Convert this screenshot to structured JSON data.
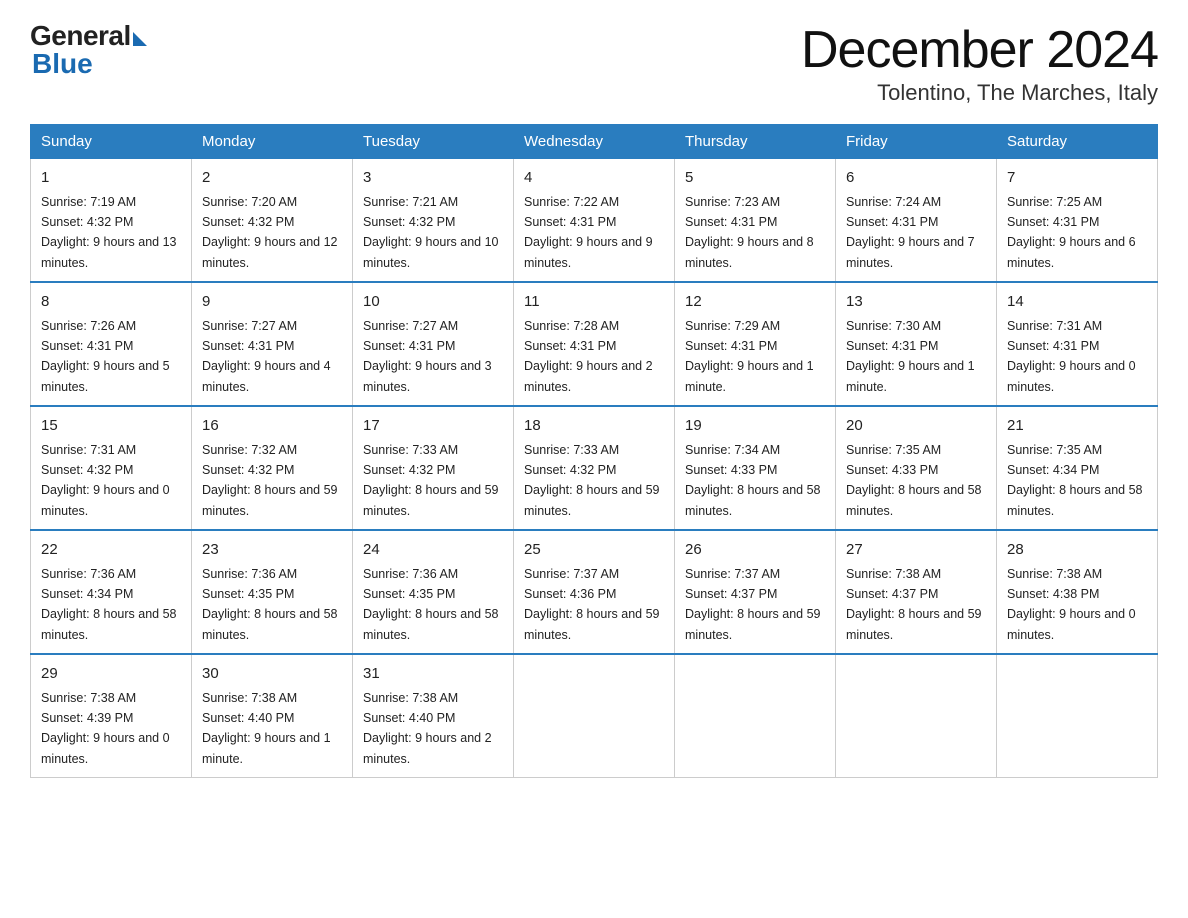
{
  "header": {
    "logo_general": "General",
    "logo_blue": "Blue",
    "month": "December 2024",
    "location": "Tolentino, The Marches, Italy"
  },
  "days_of_week": [
    "Sunday",
    "Monday",
    "Tuesday",
    "Wednesday",
    "Thursday",
    "Friday",
    "Saturday"
  ],
  "weeks": [
    [
      {
        "day": "1",
        "sunrise": "7:19 AM",
        "sunset": "4:32 PM",
        "daylight": "9 hours and 13 minutes."
      },
      {
        "day": "2",
        "sunrise": "7:20 AM",
        "sunset": "4:32 PM",
        "daylight": "9 hours and 12 minutes."
      },
      {
        "day": "3",
        "sunrise": "7:21 AM",
        "sunset": "4:32 PM",
        "daylight": "9 hours and 10 minutes."
      },
      {
        "day": "4",
        "sunrise": "7:22 AM",
        "sunset": "4:31 PM",
        "daylight": "9 hours and 9 minutes."
      },
      {
        "day": "5",
        "sunrise": "7:23 AM",
        "sunset": "4:31 PM",
        "daylight": "9 hours and 8 minutes."
      },
      {
        "day": "6",
        "sunrise": "7:24 AM",
        "sunset": "4:31 PM",
        "daylight": "9 hours and 7 minutes."
      },
      {
        "day": "7",
        "sunrise": "7:25 AM",
        "sunset": "4:31 PM",
        "daylight": "9 hours and 6 minutes."
      }
    ],
    [
      {
        "day": "8",
        "sunrise": "7:26 AM",
        "sunset": "4:31 PM",
        "daylight": "9 hours and 5 minutes."
      },
      {
        "day": "9",
        "sunrise": "7:27 AM",
        "sunset": "4:31 PM",
        "daylight": "9 hours and 4 minutes."
      },
      {
        "day": "10",
        "sunrise": "7:27 AM",
        "sunset": "4:31 PM",
        "daylight": "9 hours and 3 minutes."
      },
      {
        "day": "11",
        "sunrise": "7:28 AM",
        "sunset": "4:31 PM",
        "daylight": "9 hours and 2 minutes."
      },
      {
        "day": "12",
        "sunrise": "7:29 AM",
        "sunset": "4:31 PM",
        "daylight": "9 hours and 1 minute."
      },
      {
        "day": "13",
        "sunrise": "7:30 AM",
        "sunset": "4:31 PM",
        "daylight": "9 hours and 1 minute."
      },
      {
        "day": "14",
        "sunrise": "7:31 AM",
        "sunset": "4:31 PM",
        "daylight": "9 hours and 0 minutes."
      }
    ],
    [
      {
        "day": "15",
        "sunrise": "7:31 AM",
        "sunset": "4:32 PM",
        "daylight": "9 hours and 0 minutes."
      },
      {
        "day": "16",
        "sunrise": "7:32 AM",
        "sunset": "4:32 PM",
        "daylight": "8 hours and 59 minutes."
      },
      {
        "day": "17",
        "sunrise": "7:33 AM",
        "sunset": "4:32 PM",
        "daylight": "8 hours and 59 minutes."
      },
      {
        "day": "18",
        "sunrise": "7:33 AM",
        "sunset": "4:32 PM",
        "daylight": "8 hours and 59 minutes."
      },
      {
        "day": "19",
        "sunrise": "7:34 AM",
        "sunset": "4:33 PM",
        "daylight": "8 hours and 58 minutes."
      },
      {
        "day": "20",
        "sunrise": "7:35 AM",
        "sunset": "4:33 PM",
        "daylight": "8 hours and 58 minutes."
      },
      {
        "day": "21",
        "sunrise": "7:35 AM",
        "sunset": "4:34 PM",
        "daylight": "8 hours and 58 minutes."
      }
    ],
    [
      {
        "day": "22",
        "sunrise": "7:36 AM",
        "sunset": "4:34 PM",
        "daylight": "8 hours and 58 minutes."
      },
      {
        "day": "23",
        "sunrise": "7:36 AM",
        "sunset": "4:35 PM",
        "daylight": "8 hours and 58 minutes."
      },
      {
        "day": "24",
        "sunrise": "7:36 AM",
        "sunset": "4:35 PM",
        "daylight": "8 hours and 58 minutes."
      },
      {
        "day": "25",
        "sunrise": "7:37 AM",
        "sunset": "4:36 PM",
        "daylight": "8 hours and 59 minutes."
      },
      {
        "day": "26",
        "sunrise": "7:37 AM",
        "sunset": "4:37 PM",
        "daylight": "8 hours and 59 minutes."
      },
      {
        "day": "27",
        "sunrise": "7:38 AM",
        "sunset": "4:37 PM",
        "daylight": "8 hours and 59 minutes."
      },
      {
        "day": "28",
        "sunrise": "7:38 AM",
        "sunset": "4:38 PM",
        "daylight": "9 hours and 0 minutes."
      }
    ],
    [
      {
        "day": "29",
        "sunrise": "7:38 AM",
        "sunset": "4:39 PM",
        "daylight": "9 hours and 0 minutes."
      },
      {
        "day": "30",
        "sunrise": "7:38 AM",
        "sunset": "4:40 PM",
        "daylight": "9 hours and 1 minute."
      },
      {
        "day": "31",
        "sunrise": "7:38 AM",
        "sunset": "4:40 PM",
        "daylight": "9 hours and 2 minutes."
      },
      null,
      null,
      null,
      null
    ]
  ]
}
